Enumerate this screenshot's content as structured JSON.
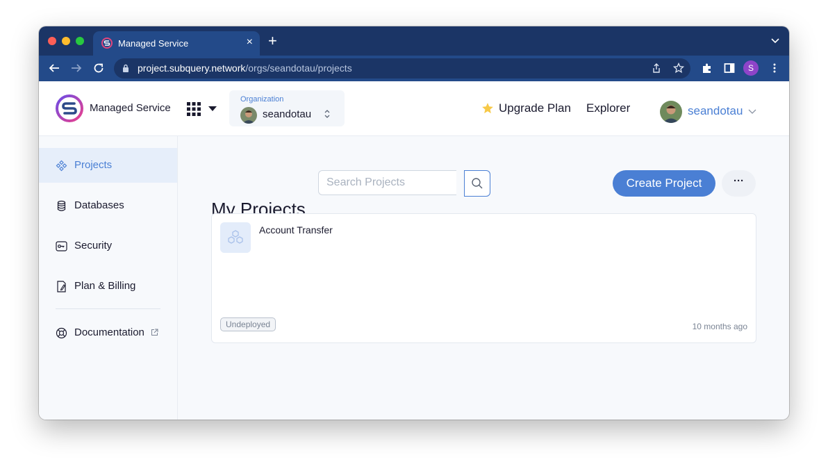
{
  "browser": {
    "tab_title": "Managed Service",
    "tab_close": "×",
    "new_tab": "+",
    "url_host": "project.subquery.network",
    "url_path": "/orgs/seandotau/projects",
    "profile_initial": "S"
  },
  "header": {
    "brand_name": "Managed Service",
    "org_label": "Organization",
    "org_name": "seandotau",
    "upgrade_label": "Upgrade Plan",
    "explorer_label": "Explorer",
    "user_name": "seandotau"
  },
  "sidebar": {
    "items": [
      {
        "label": "Projects",
        "icon": "projects-icon",
        "active": true
      },
      {
        "label": "Databases",
        "icon": "database-icon",
        "active": false
      },
      {
        "label": "Security",
        "icon": "key-icon",
        "active": false
      },
      {
        "label": "Plan & Billing",
        "icon": "billing-icon",
        "active": false
      },
      {
        "label": "Documentation",
        "icon": "lifebuoy-icon",
        "active": false
      }
    ]
  },
  "main": {
    "title": "My Projects",
    "search_placeholder": "Search Projects",
    "create_label": "Create Project",
    "more_label": "···",
    "projects": [
      {
        "name": "Account Transfer",
        "status": "Undeployed",
        "updated": "10 months ago"
      }
    ]
  },
  "colors": {
    "accent": "#4a7fd4",
    "chrome_dark": "#1b3566",
    "chrome_tab": "#234a89"
  }
}
